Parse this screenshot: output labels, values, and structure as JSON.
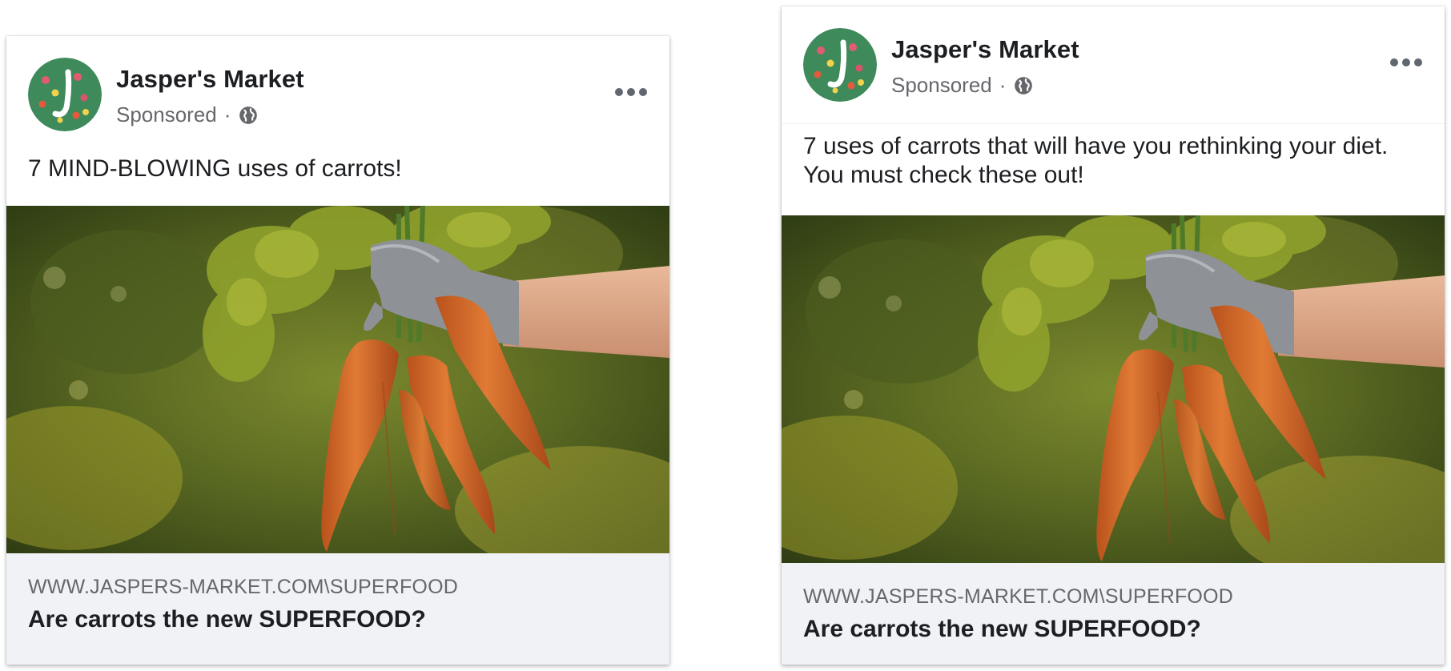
{
  "colors": {
    "page_name": "#1c1e21",
    "meta": "#65676b",
    "link_box_bg": "#f0f2f5",
    "avatar_bg": "#3f8a5b"
  },
  "ads": [
    {
      "page_name": "Jasper's Market",
      "sponsored": "Sponsored",
      "separator": "·",
      "audience_icon": "globe-icon",
      "more_icon": "more-options-icon",
      "caption": "7 MIND-BLOWING uses of carrots!",
      "image": "carrots-in-gloved-hand-photo",
      "link_url": "WWW.JASPERS-MARKET.COM\\SUPERFOOD",
      "link_title": "Are carrots the new SUPERFOOD?"
    },
    {
      "page_name": "Jasper's Market",
      "sponsored": "Sponsored",
      "separator": "·",
      "audience_icon": "globe-icon",
      "more_icon": "more-options-icon",
      "caption": "7 uses of carrots that will have you rethinking your diet. You must check these out!",
      "image": "carrots-in-gloved-hand-photo",
      "link_url": "WWW.JASPERS-MARKET.COM\\SUPERFOOD",
      "link_title": "Are carrots the new SUPERFOOD?"
    }
  ]
}
